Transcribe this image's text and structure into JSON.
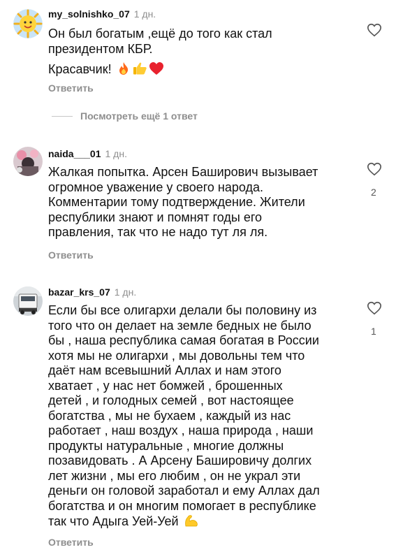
{
  "comments": [
    {
      "username": "my_solnishko_07",
      "time": "1 дн.",
      "lines": [
        "Он был богатым ,ещё до того как стал",
        "президентом КБР."
      ],
      "line2": "Красавчик!",
      "emoji_icons": [
        "fire-icon",
        "thumbs-up-icon",
        "red-heart-icon"
      ],
      "reply_label": "Ответить",
      "likes": ""
    },
    {
      "username": "naida___01",
      "time": "1 дн.",
      "lines": [
        "Жалкая попытка. Арсен Баширович вызывает",
        "огромное уважение у своего народа.",
        "Комментарии тому подтверждение. Жители",
        "республики знают и помнят годы его",
        "правления, так что не надо тут ля ля."
      ],
      "reply_label": "Ответить",
      "likes": "2"
    },
    {
      "username": "bazar_krs_07",
      "time": "1 дн.",
      "lines": [
        "Если бы все олигархи делали бы половину из",
        "того что он делает на земле бедных не было",
        "бы , наша республика самая богатая в России",
        "хотя мы не олигархи , мы довольны тем что",
        "даёт нам всевышний Аллах и нам этого",
        "хватает , у нас нет бомжей , брошенных",
        "детей , и голодных семей , вот настоящее",
        "богатства , мы не бухаем , каждый из нас",
        "работает , наш воздух , наша природа , наши",
        "продукты натуральные , многие должны",
        "позавидовать . А Арсену Башировичу долгих",
        "лет жизни , мы его любим , он не украл эти",
        "деньги он головой заработал и ему Аллах дал",
        "богатства и он многим помогает в республике",
        "так что Адыга Уей-Уей"
      ],
      "trailing_emoji": "flexed-biceps-icon",
      "reply_label": "Ответить",
      "likes": "1"
    }
  ],
  "view_more_replies": "Посмотреть ещё 1 ответ"
}
